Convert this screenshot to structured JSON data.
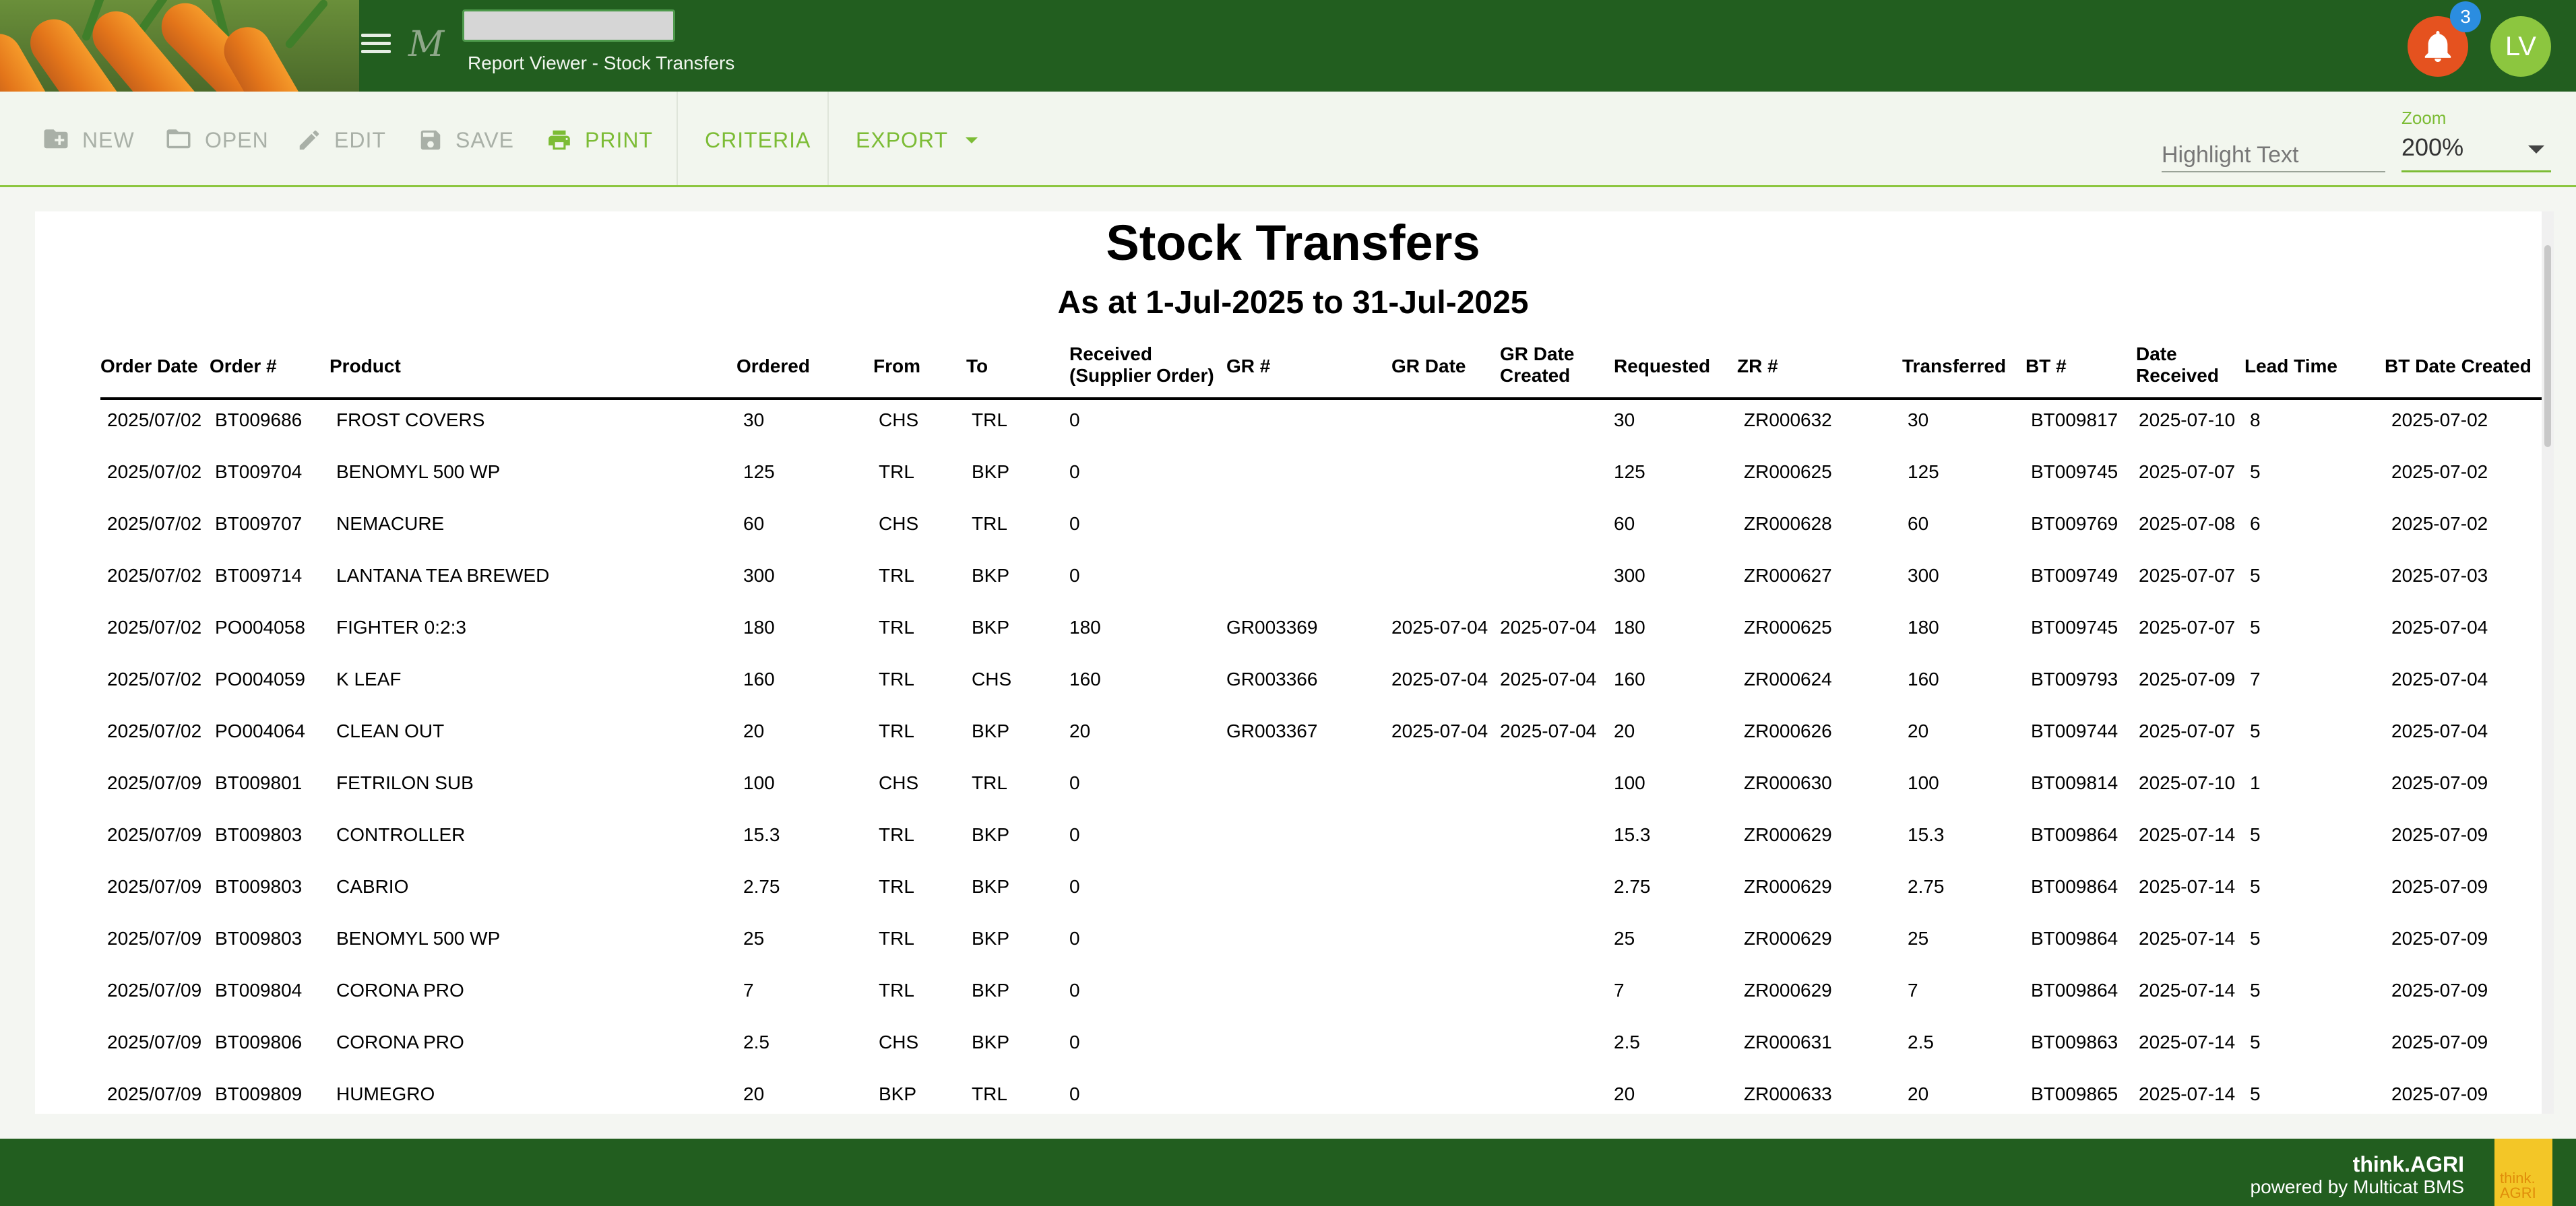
{
  "header": {
    "logo_icon": "m-logo-icon",
    "subtitle": "Report Viewer - Stock Transfers",
    "notification_count": "3",
    "avatar_initials": "LV",
    "colors": {
      "header_bg": "#225e1f",
      "bell_bg": "#e5521f",
      "badge_bg": "#2b8de0",
      "avatar_bg": "#8cc63f"
    }
  },
  "toolbar": {
    "new_label": "NEW",
    "open_label": "OPEN",
    "edit_label": "EDIT",
    "save_label": "SAVE",
    "print_label": "PRINT",
    "criteria_label": "CRITERIA",
    "export_label": "EXPORT",
    "highlight_placeholder": "Highlight Text",
    "zoom_label": "Zoom",
    "zoom_value": "200%",
    "accent_color": "#7cbc35"
  },
  "report": {
    "title": "Stock Transfers",
    "subtitle": "As at 1-Jul-2025 to 31-Jul-2025",
    "columns": [
      "Order Date",
      "Order #",
      "Product",
      "Ordered",
      "From",
      "To",
      "Received (Supplier Order)",
      "GR #",
      "GR Date",
      "GR Date Created",
      "Requested",
      "ZR #",
      "Transferred",
      "BT #",
      "Date Received",
      "Lead Time",
      "BT Date Created"
    ],
    "rows": [
      [
        "2025/07/02",
        "BT009686",
        "FROST COVERS",
        "30",
        "CHS",
        "TRL",
        "0",
        "",
        "",
        "",
        "30",
        "ZR000632",
        "30",
        "BT009817",
        "2025-07-10",
        "8",
        "2025-07-02"
      ],
      [
        "2025/07/02",
        "BT009704",
        "BENOMYL 500 WP",
        "125",
        "TRL",
        "BKP",
        "0",
        "",
        "",
        "",
        "125",
        "ZR000625",
        "125",
        "BT009745",
        "2025-07-07",
        "5",
        "2025-07-02"
      ],
      [
        "2025/07/02",
        "BT009707",
        "NEMACURE",
        "60",
        "CHS",
        "TRL",
        "0",
        "",
        "",
        "",
        "60",
        "ZR000628",
        "60",
        "BT009769",
        "2025-07-08",
        "6",
        "2025-07-02"
      ],
      [
        "2025/07/02",
        "BT009714",
        "LANTANA TEA BREWED",
        "300",
        "TRL",
        "BKP",
        "0",
        "",
        "",
        "",
        "300",
        "ZR000627",
        "300",
        "BT009749",
        "2025-07-07",
        "5",
        "2025-07-03"
      ],
      [
        "2025/07/02",
        "PO004058",
        "FIGHTER 0:2:3",
        "180",
        "TRL",
        "BKP",
        "180",
        "GR003369",
        "2025-07-04",
        "2025-07-04",
        "180",
        "ZR000625",
        "180",
        "BT009745",
        "2025-07-07",
        "5",
        "2025-07-04"
      ],
      [
        "2025/07/02",
        "PO004059",
        "K LEAF",
        "160",
        "TRL",
        "CHS",
        "160",
        "GR003366",
        "2025-07-04",
        "2025-07-04",
        "160",
        "ZR000624",
        "160",
        "BT009793",
        "2025-07-09",
        "7",
        "2025-07-04"
      ],
      [
        "2025/07/02",
        "PO004064",
        "CLEAN OUT",
        "20",
        "TRL",
        "BKP",
        "20",
        "GR003367",
        "2025-07-04",
        "2025-07-04",
        "20",
        "ZR000626",
        "20",
        "BT009744",
        "2025-07-07",
        "5",
        "2025-07-04"
      ],
      [
        "2025/07/09",
        "BT009801",
        "FETRILON SUB",
        "100",
        "CHS",
        "TRL",
        "0",
        "",
        "",
        "",
        "100",
        "ZR000630",
        "100",
        "BT009814",
        "2025-07-10",
        "1",
        "2025-07-09"
      ],
      [
        "2025/07/09",
        "BT009803",
        "CONTROLLER",
        "15.3",
        "TRL",
        "BKP",
        "0",
        "",
        "",
        "",
        "15.3",
        "ZR000629",
        "15.3",
        "BT009864",
        "2025-07-14",
        "5",
        "2025-07-09"
      ],
      [
        "2025/07/09",
        "BT009803",
        "CABRIO",
        "2.75",
        "TRL",
        "BKP",
        "0",
        "",
        "",
        "",
        "2.75",
        "ZR000629",
        "2.75",
        "BT009864",
        "2025-07-14",
        "5",
        "2025-07-09"
      ],
      [
        "2025/07/09",
        "BT009803",
        "BENOMYL 500 WP",
        "25",
        "TRL",
        "BKP",
        "0",
        "",
        "",
        "",
        "25",
        "ZR000629",
        "25",
        "BT009864",
        "2025-07-14",
        "5",
        "2025-07-09"
      ],
      [
        "2025/07/09",
        "BT009804",
        "CORONA PRO",
        "7",
        "TRL",
        "BKP",
        "0",
        "",
        "",
        "",
        "7",
        "ZR000629",
        "7",
        "BT009864",
        "2025-07-14",
        "5",
        "2025-07-09"
      ],
      [
        "2025/07/09",
        "BT009806",
        "CORONA PRO",
        "2.5",
        "CHS",
        "BKP",
        "0",
        "",
        "",
        "",
        "2.5",
        "ZR000631",
        "2.5",
        "BT009863",
        "2025-07-14",
        "5",
        "2025-07-09"
      ],
      [
        "2025/07/09",
        "BT009809",
        "HUMEGRO",
        "20",
        "BKP",
        "TRL",
        "0",
        "",
        "",
        "",
        "20",
        "ZR000633",
        "20",
        "BT009865",
        "2025-07-14",
        "5",
        "2025-07-09"
      ]
    ]
  },
  "footer": {
    "brand": "think.AGRI",
    "powered_by": "powered by Multicat BMS",
    "logo_line1": "think.",
    "logo_line2": "AGRI"
  }
}
